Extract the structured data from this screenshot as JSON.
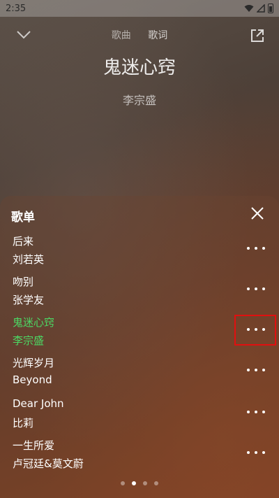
{
  "status_bar": {
    "time": "2:35"
  },
  "top_nav": {
    "tabs": [
      {
        "label": "歌曲"
      },
      {
        "label": "歌词"
      }
    ]
  },
  "now_playing": {
    "title": "鬼迷心窍",
    "artist": "李宗盛"
  },
  "playlist": {
    "title": "歌单",
    "tracks": [
      {
        "name": "后来",
        "artist": "刘若英"
      },
      {
        "name": "吻别",
        "artist": "张学友"
      },
      {
        "name": "鬼迷心窍",
        "artist": "李宗盛"
      },
      {
        "name": "光辉岁月",
        "artist": "Beyond"
      },
      {
        "name": "Dear John",
        "artist": "比莉"
      },
      {
        "name": "一生所爱",
        "artist": "卢冠廷&莫文蔚"
      }
    ],
    "current_index": 2,
    "page_count": 4,
    "active_page": 1
  },
  "colors": {
    "current_track": "#4cd964",
    "highlight": "#e01010"
  },
  "icons": {
    "collapse": "chevron-down-icon",
    "share": "share-icon",
    "close": "close-icon",
    "more": "more-horizontal-icon"
  }
}
